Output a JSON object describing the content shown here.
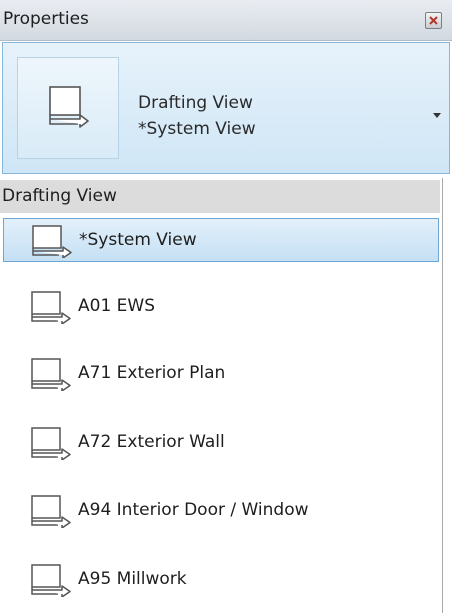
{
  "panel": {
    "title": "Properties",
    "close_icon": "close-icon"
  },
  "type_selector": {
    "family": "Drafting View",
    "type": "*System View",
    "preview_icon": "drafting-view-icon",
    "arrow_icon": "chevron-down-icon"
  },
  "dropdown": {
    "group_label": "Drafting View",
    "items": [
      {
        "label": "*System View",
        "selected": true
      },
      {
        "label": "A01 EWS",
        "selected": false
      },
      {
        "label": "A71 Exterior Plan",
        "selected": false
      },
      {
        "label": "A72 Exterior Wall",
        "selected": false
      },
      {
        "label": "A94 Interior Door / Window",
        "selected": false
      },
      {
        "label": "A95 Millwork",
        "selected": false
      }
    ]
  },
  "colors": {
    "selection_fill": "#cfe6f6",
    "selection_border": "#6fa7d4",
    "group_header": "#dcdcdc"
  }
}
